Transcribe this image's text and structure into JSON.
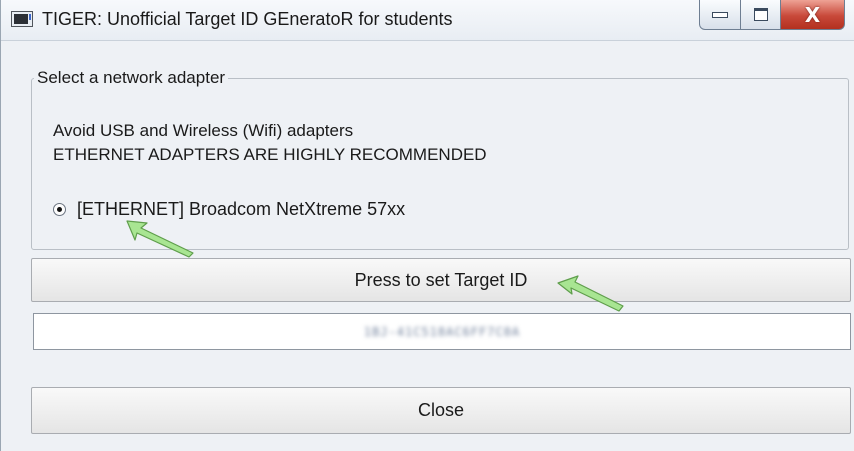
{
  "window": {
    "title": "TIGER: Unofficial Target ID GEneratoR for students",
    "controls": {
      "minimize_icon": "minimize-icon",
      "maximize_icon": "maximize-icon",
      "close_icon": "close-icon",
      "close_glyph": "X"
    }
  },
  "adapter_group": {
    "legend": "Select a network adapter",
    "warning_line1": "Avoid USB and Wireless (Wifi) adapters",
    "warning_line2": "ETHERNET ADAPTERS ARE HIGHLY RECOMMENDED",
    "options": [
      {
        "label": "[ETHERNET] Broadcom NetXtreme 57xx",
        "selected": true
      }
    ]
  },
  "actions": {
    "set_target_label": "Press to set Target ID",
    "close_label": "Close"
  },
  "target_id_field": {
    "value": "1BJ-41C518AC6FF7C0A"
  },
  "annotations": {
    "arrow_color": "#9fe08a",
    "arrow_icon": "pointer-arrow-icon"
  }
}
